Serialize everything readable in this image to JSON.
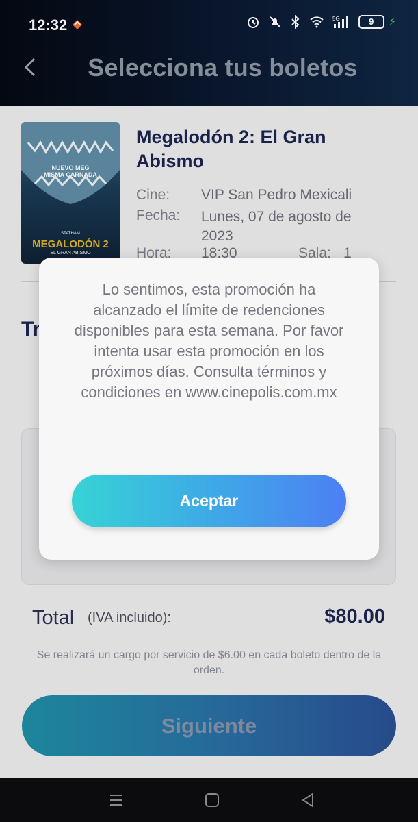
{
  "status_bar": {
    "time": "12:32",
    "battery": "9"
  },
  "header": {
    "title": "Selecciona tus boletos"
  },
  "movie": {
    "poster_tagline": "NUEVO MEG\nMISMA CARNADA",
    "poster_title": "MEGALODÓN 2",
    "poster_subtitle": "EL GRAN ABISMO",
    "poster_star": "STATHAM",
    "title": "Megalodón 2: El Gran Abismo",
    "cine_label": "Cine:",
    "cine_value": "VIP San Pedro Mexicali",
    "fecha_label": "Fecha:",
    "fecha_value": "Lunes, 07 de agosto de 2023",
    "hora_label": "Hora:",
    "hora_value": "18:30",
    "sala_label": "Sala:",
    "sala_value": "1"
  },
  "tickets": {
    "section_title": "Tr"
  },
  "summary": {
    "total_label": "Total",
    "total_note": "(IVA incluido):",
    "total_amount": "$80.00",
    "fee_note": "Se realizará un cargo por servicio de $6.00 en cada boleto dentro de la orden."
  },
  "next_button": "Siguiente",
  "modal": {
    "message": "Lo sentimos, esta promoción ha alcanzado el límite de redenciones disponibles para esta semana. Por favor intenta usar esta promoción en los próximos días. Consulta términos y condiciones en www.cinepolis.com.mx",
    "accept_label": "Aceptar"
  },
  "icons": [
    "back-arrow-icon",
    "alarm-icon",
    "mute-icon",
    "bluetooth-icon",
    "wifi-icon",
    "signal-icon",
    "battery-icon",
    "menu-icon",
    "home-icon",
    "back-icon"
  ],
  "colors": {
    "accent_start": "#36d3d6",
    "accent_end": "#4d7ff4",
    "title_navy": "#1c2550",
    "header_bg": "#050913"
  }
}
